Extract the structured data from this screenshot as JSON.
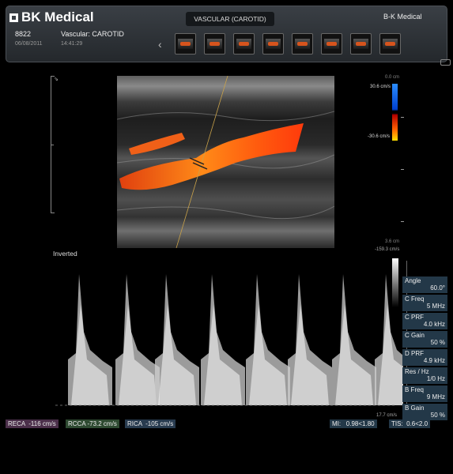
{
  "header": {
    "brand": "BK Medical",
    "patient_id": "8822",
    "exam_date": "06/08/2011",
    "exam_name": "Vascular: CAROTID",
    "exam_time": "14:41:29",
    "exam_type": "VASCULAR (CAROTID)",
    "clinic": "B-K Medical",
    "thumbnail_count": 8
  },
  "color_doppler": {
    "depth_top": "0.0 cm",
    "depth_bottom": "3.6 cm",
    "velocity_max": "30.6 cm/s",
    "velocity_min": "-30.6 cm/s"
  },
  "spectral": {
    "mode_label": "Inverted",
    "velocity_top": "-159.3 cm/s",
    "velocity_bottom": "17.7 cm/s"
  },
  "parameters": [
    {
      "name": "Angle",
      "value": "60.0°"
    },
    {
      "name": "C Freq",
      "value": "5 MHz"
    },
    {
      "name": "C PRF",
      "value": "4.0 kHz"
    },
    {
      "name": "C Gain",
      "value": "50 %"
    },
    {
      "name": "D PRF",
      "value": "4.9 kHz"
    },
    {
      "name": "Res / Hz",
      "value": "1/0 Hz"
    },
    {
      "name": "B Freq",
      "value": "9 MHz"
    },
    {
      "name": "B Gain",
      "value": "50 %"
    }
  ],
  "measurements": [
    {
      "label": "RECA",
      "value": "-116 cm/s"
    },
    {
      "label": "RCCA",
      "value": "-73.2 cm/s"
    },
    {
      "label": "RICA",
      "value": "-105 cm/s"
    }
  ],
  "safety": {
    "mi_label": "MI:",
    "mi_value": "0.98<1.80",
    "tis_label": "TIS:",
    "tis_value": "0.6<2.0"
  }
}
